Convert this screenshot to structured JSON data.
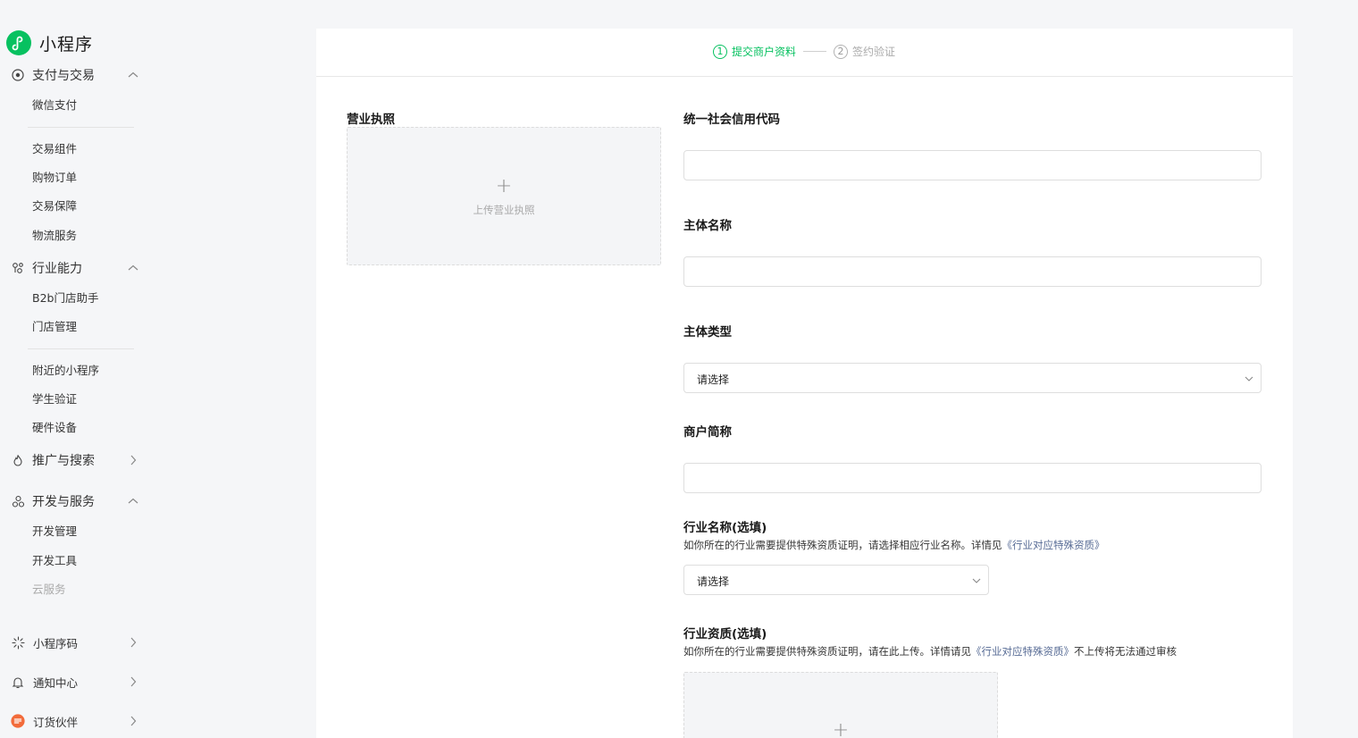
{
  "app": {
    "title": "小程序",
    "brand_color": "#07c160"
  },
  "sidebar": {
    "sections": [
      {
        "id": "pay",
        "label": "支付与交易",
        "icon": "yuan-circle-icon",
        "expanded": true,
        "items": [
          "微信支付",
          "交易组件",
          "购物订单",
          "交易保障",
          "物流服务"
        ]
      },
      {
        "id": "industry",
        "label": "行业能力",
        "icon": "nodes-icon",
        "expanded": true,
        "items": [
          "B2b门店助手",
          "门店管理",
          "附近的小程序",
          "学生验证",
          "硬件设备"
        ]
      },
      {
        "id": "promo",
        "label": "推广与搜索",
        "icon": "flame-icon",
        "expanded": false,
        "items": []
      },
      {
        "id": "dev",
        "label": "开发与服务",
        "icon": "cluster-icon",
        "expanded": true,
        "items": [
          "开发管理",
          "开发工具",
          "云服务"
        ]
      },
      {
        "id": "qrcode",
        "label": "小程序码",
        "icon": "sparkle-icon",
        "expanded": false,
        "items": []
      },
      {
        "id": "notify",
        "label": "通知中心",
        "icon": "bell-icon",
        "expanded": false,
        "items": []
      },
      {
        "id": "partner",
        "label": "订货伙伴",
        "icon": "partner-logo-icon",
        "expanded": false,
        "items": []
      }
    ]
  },
  "steps": [
    {
      "num": "1",
      "label": "提交商户资料",
      "active": true
    },
    {
      "num": "2",
      "label": "签约验证",
      "active": false
    }
  ],
  "form": {
    "license": {
      "label": "营业执照",
      "upload_text": "上传营业执照"
    },
    "credit_code": {
      "label": "统一社会信用代码",
      "value": ""
    },
    "entity_name": {
      "label": "主体名称",
      "value": ""
    },
    "entity_type": {
      "label": "主体类型",
      "value": "请选择"
    },
    "short_name": {
      "label": "商户简称",
      "value": ""
    },
    "industry_name": {
      "label": "行业名称(选填)",
      "desc": "如你所在的行业需要提供特殊资质证明，请选择相应行业名称。详情见",
      "link": "《行业对应特殊资质》",
      "value": "请选择"
    },
    "industry_qual": {
      "label": "行业资质(选填)",
      "desc": "如你所在的行业需要提供特殊资质证明，请在此上传。详情请见",
      "link": "《行业对应特殊资质》",
      "desc_after": "不上传将无法通过审核"
    }
  }
}
